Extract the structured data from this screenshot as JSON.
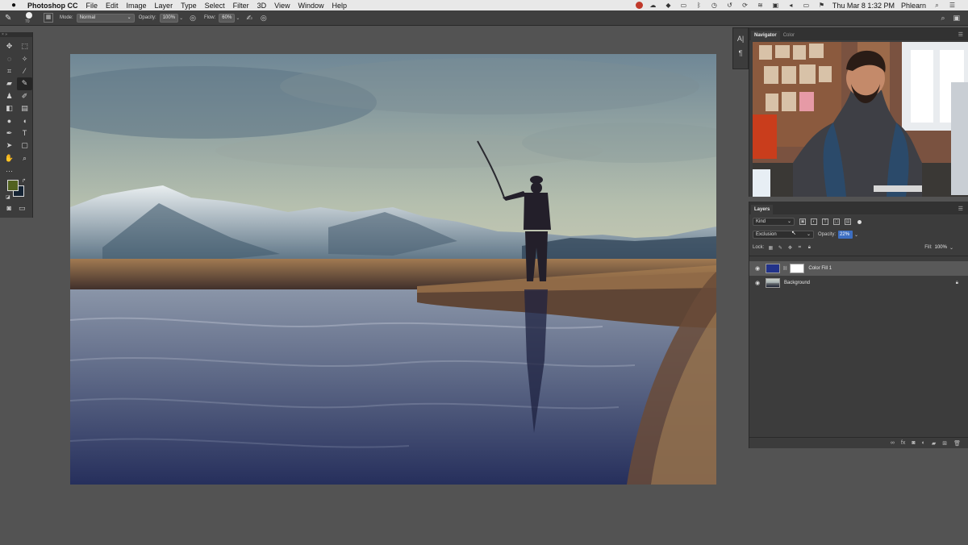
{
  "menubar": {
    "app_name": "Photoshop CC",
    "items": [
      "File",
      "Edit",
      "Image",
      "Layer",
      "Type",
      "Select",
      "Filter",
      "3D",
      "View",
      "Window",
      "Help"
    ],
    "clock": "Thu Mar 8  1:32 PM",
    "user": "Phlearn"
  },
  "options_bar": {
    "brush_size": "70",
    "mode_label": "Mode:",
    "mode_value": "Normal",
    "opacity_label": "Opacity:",
    "opacity_value": "100%",
    "flow_label": "Flow:",
    "flow_value": "60%"
  },
  "navigator": {
    "tabs": [
      "Navigator",
      "Color"
    ]
  },
  "layers": {
    "title": "Layers",
    "filter_kind": "Kind",
    "blend_mode": "Exclusion",
    "opacity_label": "Opacity:",
    "opacity_value": "22%",
    "lock_label": "Lock:",
    "fill_label": "Fill:",
    "fill_value": "100%",
    "items": [
      {
        "name": "Color Fill 1",
        "selected": true
      },
      {
        "name": "Background",
        "selected": false
      }
    ]
  },
  "colors": {
    "foreground": "#526220",
    "background": "#152434",
    "accent": "#3d6fc2"
  }
}
